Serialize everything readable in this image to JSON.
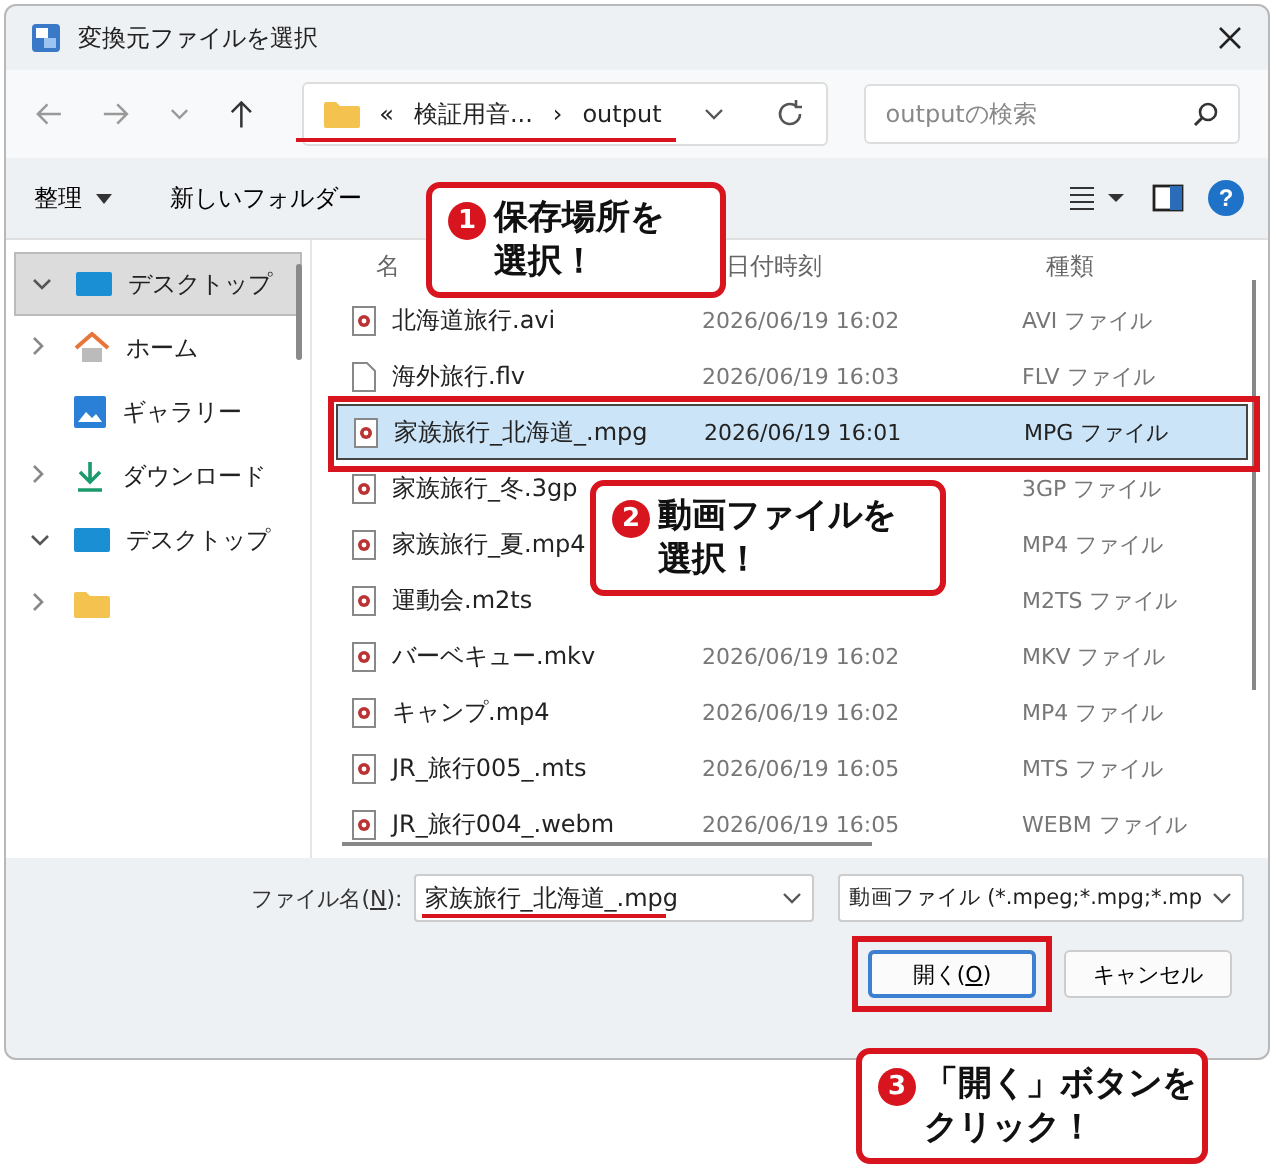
{
  "window": {
    "title": "変換元ファイルを選択"
  },
  "nav": {
    "breadcrumb": [
      "«",
      "検証用音...",
      "›",
      "output"
    ],
    "search_placeholder": "outputの検索"
  },
  "toolbar": {
    "organize": "整理",
    "new_folder": "新しいフォルダー",
    "help": "?"
  },
  "sidebar": {
    "items": [
      {
        "label": "デスクトップ",
        "expanded": true,
        "selected": true
      },
      {
        "label": "ホーム",
        "expanded": false,
        "selected": false
      },
      {
        "label": "ギャラリー",
        "selected": false
      },
      {
        "label": "ダウンロード",
        "expanded": false,
        "selected": false
      },
      {
        "label": "デスクトップ",
        "expanded": true,
        "selected": false
      },
      {
        "expanded": false,
        "selected": false
      }
    ]
  },
  "columns": [
    "名",
    "日付時刻",
    "種類"
  ],
  "files": [
    {
      "name": "北海道旅行.avi",
      "date": "2026/06/19 16:02",
      "type": "AVI ファイル",
      "kind": "video",
      "selected": false
    },
    {
      "name": "海外旅行.flv",
      "date": "2026/06/19 16:03",
      "type": "FLV ファイル",
      "kind": "blank",
      "selected": false
    },
    {
      "name": "家族旅行_北海道_.mpg",
      "date": "2026/06/19 16:01",
      "type": "MPG ファイル",
      "kind": "video",
      "selected": true
    },
    {
      "name": "家族旅行_冬.3gp",
      "type": "3GP ファイル",
      "kind": "video",
      "selected": false
    },
    {
      "name": "家族旅行_夏.mp4",
      "type": "MP4 ファイル",
      "kind": "video",
      "selected": false
    },
    {
      "name": "運動会.m2ts",
      "type": "M2TS ファイル",
      "kind": "video",
      "selected": false
    },
    {
      "name": "バーベキュー.mkv",
      "date": "2026/06/19 16:02",
      "type": "MKV ファイル",
      "kind": "video",
      "selected": false
    },
    {
      "name": "キャンプ.mp4",
      "date": "2026/06/19 16:02",
      "type": "MP4 ファイル",
      "kind": "video",
      "selected": false
    },
    {
      "name": "JR_旅行005_.mts",
      "date": "2026/06/19 16:05",
      "type": "MTS ファイル",
      "kind": "video",
      "selected": false
    },
    {
      "name": "JR_旅行004_.webm",
      "date": "2026/06/19 16:05",
      "type": "WEBM ファイル",
      "kind": "video",
      "selected": false
    }
  ],
  "filename": {
    "label": "ファイル名(",
    "accel": "N",
    "label_end": "):",
    "value": "家族旅行_北海道_.mpg"
  },
  "filter": {
    "value": "動画ファイル (*.mpeg;*.mpg;*.mp"
  },
  "buttons": {
    "open": {
      "label": "開く(",
      "accel": "O",
      "label_end": ")"
    },
    "cancel": "キャンセル"
  },
  "callouts": [
    {
      "number": "1",
      "lines": [
        "保存場所を",
        "選択！"
      ]
    },
    {
      "number": "2",
      "lines": [
        "動画ファイルを",
        "選択！"
      ]
    },
    {
      "number": "3",
      "lines": [
        "「開く」ボタンを",
        "クリック！"
      ]
    }
  ]
}
